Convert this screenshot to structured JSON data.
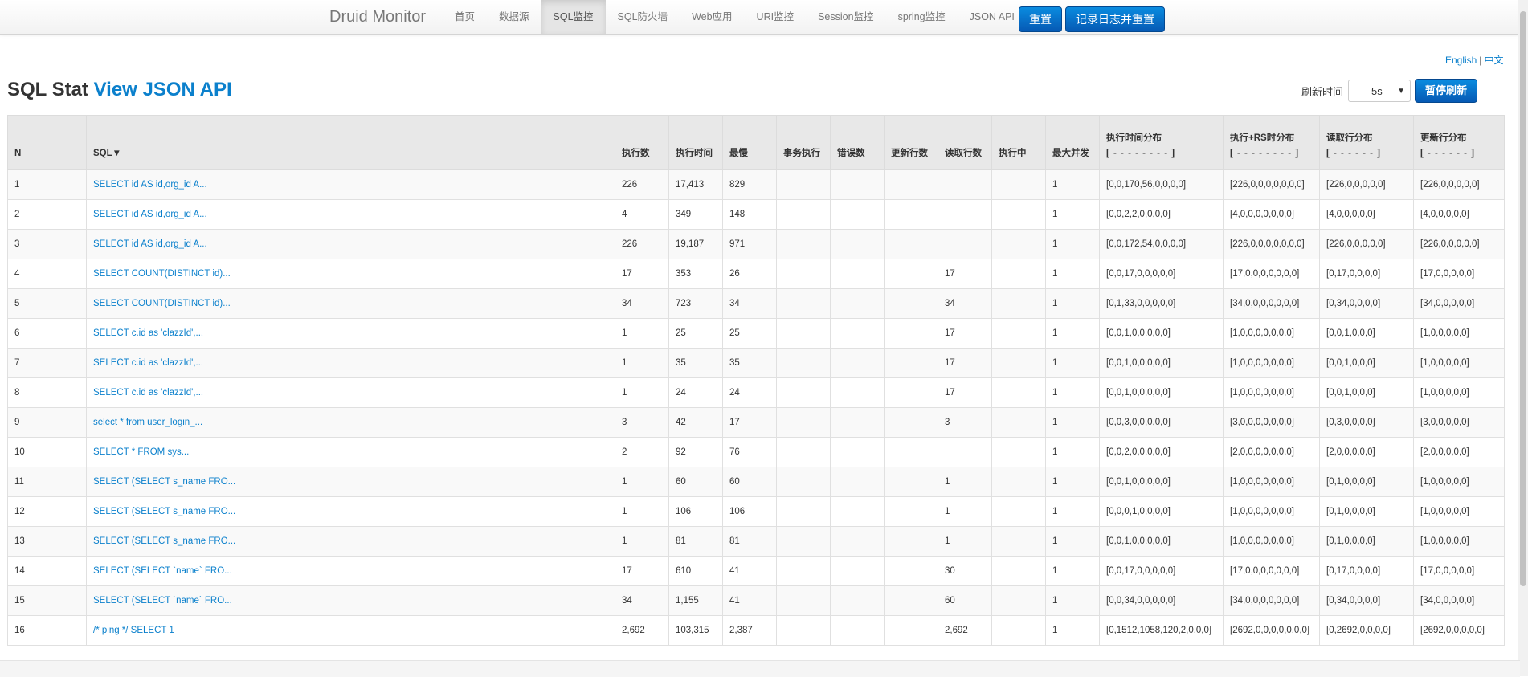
{
  "brand": "Druid Monitor",
  "nav": [
    {
      "label": "首页",
      "active": false
    },
    {
      "label": "数据源",
      "active": false
    },
    {
      "label": "SQL监控",
      "active": true
    },
    {
      "label": "SQL防火墙",
      "active": false
    },
    {
      "label": "Web应用",
      "active": false
    },
    {
      "label": "URI监控",
      "active": false
    },
    {
      "label": "Session监控",
      "active": false
    },
    {
      "label": "spring监控",
      "active": false
    },
    {
      "label": "JSON API",
      "active": false
    }
  ],
  "buttons": {
    "reset": "重置",
    "log_reset": "记录日志并重置"
  },
  "lang": {
    "english": "English",
    "sep": "|",
    "chinese": "中文"
  },
  "title": {
    "main": "SQL Stat",
    "link": "View JSON API"
  },
  "refresh": {
    "label": "刷新时间",
    "value": "5s",
    "pause": "暂停刷新"
  },
  "columns": [
    "N",
    "SQL▼",
    "执行数",
    "执行时间",
    "最慢",
    "事务执行",
    "错误数",
    "更新行数",
    "读取行数",
    "执行中",
    "最大并发",
    {
      "title": "执行时间分布",
      "sub": "[ - - - - - - - - ]"
    },
    {
      "title": "执行+RS时分布",
      "sub": "[ - - - - - - - - ]"
    },
    {
      "title": "读取行分布",
      "sub": "[ - - - - - - ]"
    },
    {
      "title": "更新行分布",
      "sub": "[ - - - - - - ]"
    }
  ],
  "rows": [
    [
      "1",
      "SELECT id AS id,org_id A...",
      "226",
      "17,413",
      "829",
      "",
      "",
      "",
      "",
      "",
      "1",
      "[0,0,170,56,0,0,0,0]",
      "[226,0,0,0,0,0,0,0]",
      "[226,0,0,0,0,0]",
      "[226,0,0,0,0,0]"
    ],
    [
      "2",
      "SELECT id AS id,org_id A...",
      "4",
      "349",
      "148",
      "",
      "",
      "",
      "",
      "",
      "1",
      "[0,0,2,2,0,0,0,0]",
      "[4,0,0,0,0,0,0,0]",
      "[4,0,0,0,0,0]",
      "[4,0,0,0,0,0]"
    ],
    [
      "3",
      "SELECT id AS id,org_id A...",
      "226",
      "19,187",
      "971",
      "",
      "",
      "",
      "",
      "",
      "1",
      "[0,0,172,54,0,0,0,0]",
      "[226,0,0,0,0,0,0,0]",
      "[226,0,0,0,0,0]",
      "[226,0,0,0,0,0]"
    ],
    [
      "4",
      "SELECT COUNT(DISTINCT id)...",
      "17",
      "353",
      "26",
      "",
      "",
      "",
      "17",
      "",
      "1",
      "[0,0,17,0,0,0,0,0]",
      "[17,0,0,0,0,0,0,0]",
      "[0,17,0,0,0,0]",
      "[17,0,0,0,0,0]"
    ],
    [
      "5",
      "SELECT COUNT(DISTINCT id)...",
      "34",
      "723",
      "34",
      "",
      "",
      "",
      "34",
      "",
      "1",
      "[0,1,33,0,0,0,0,0]",
      "[34,0,0,0,0,0,0,0]",
      "[0,34,0,0,0,0]",
      "[34,0,0,0,0,0]"
    ],
    [
      "6",
      "SELECT c.id as 'clazzId',...",
      "1",
      "25",
      "25",
      "",
      "",
      "",
      "17",
      "",
      "1",
      "[0,0,1,0,0,0,0,0]",
      "[1,0,0,0,0,0,0,0]",
      "[0,0,1,0,0,0]",
      "[1,0,0,0,0,0]"
    ],
    [
      "7",
      "SELECT c.id as 'clazzId',...",
      "1",
      "35",
      "35",
      "",
      "",
      "",
      "17",
      "",
      "1",
      "[0,0,1,0,0,0,0,0]",
      "[1,0,0,0,0,0,0,0]",
      "[0,0,1,0,0,0]",
      "[1,0,0,0,0,0]"
    ],
    [
      "8",
      "SELECT c.id as 'clazzId',...",
      "1",
      "24",
      "24",
      "",
      "",
      "",
      "17",
      "",
      "1",
      "[0,0,1,0,0,0,0,0]",
      "[1,0,0,0,0,0,0,0]",
      "[0,0,1,0,0,0]",
      "[1,0,0,0,0,0]"
    ],
    [
      "9",
      "select * from user_login_...",
      "3",
      "42",
      "17",
      "",
      "",
      "",
      "3",
      "",
      "1",
      "[0,0,3,0,0,0,0,0]",
      "[3,0,0,0,0,0,0,0]",
      "[0,3,0,0,0,0]",
      "[3,0,0,0,0,0]"
    ],
    [
      "10",
      "SELECT * FROM sys...",
      "2",
      "92",
      "76",
      "",
      "",
      "",
      "",
      "",
      "1",
      "[0,0,2,0,0,0,0,0]",
      "[2,0,0,0,0,0,0,0]",
      "[2,0,0,0,0,0]",
      "[2,0,0,0,0,0]"
    ],
    [
      "11",
      "SELECT (SELECT s_name FRO...",
      "1",
      "60",
      "60",
      "",
      "",
      "",
      "1",
      "",
      "1",
      "[0,0,1,0,0,0,0,0]",
      "[1,0,0,0,0,0,0,0]",
      "[0,1,0,0,0,0]",
      "[1,0,0,0,0,0]"
    ],
    [
      "12",
      "SELECT (SELECT s_name FRO...",
      "1",
      "106",
      "106",
      "",
      "",
      "",
      "1",
      "",
      "1",
      "[0,0,0,1,0,0,0,0]",
      "[1,0,0,0,0,0,0,0]",
      "[0,1,0,0,0,0]",
      "[1,0,0,0,0,0]"
    ],
    [
      "13",
      "SELECT (SELECT s_name FRO...",
      "1",
      "81",
      "81",
      "",
      "",
      "",
      "1",
      "",
      "1",
      "[0,0,1,0,0,0,0,0]",
      "[1,0,0,0,0,0,0,0]",
      "[0,1,0,0,0,0]",
      "[1,0,0,0,0,0]"
    ],
    [
      "14",
      "SELECT (SELECT `name` FRO...",
      "17",
      "610",
      "41",
      "",
      "",
      "",
      "30",
      "",
      "1",
      "[0,0,17,0,0,0,0,0]",
      "[17,0,0,0,0,0,0,0]",
      "[0,17,0,0,0,0]",
      "[17,0,0,0,0,0]"
    ],
    [
      "15",
      "SELECT (SELECT `name` FRO...",
      "34",
      "1,155",
      "41",
      "",
      "",
      "",
      "60",
      "",
      "1",
      "[0,0,34,0,0,0,0,0]",
      "[34,0,0,0,0,0,0,0]",
      "[0,34,0,0,0,0]",
      "[34,0,0,0,0,0]"
    ],
    [
      "16",
      "/* ping */ SELECT 1",
      "2,692",
      "103,315",
      "2,387",
      "",
      "",
      "",
      "2,692",
      "",
      "1",
      "[0,1512,1058,120,2,0,0,0]",
      "[2692,0,0,0,0,0,0,0]",
      "[0,2692,0,0,0,0]",
      "[2692,0,0,0,0,0]"
    ]
  ]
}
